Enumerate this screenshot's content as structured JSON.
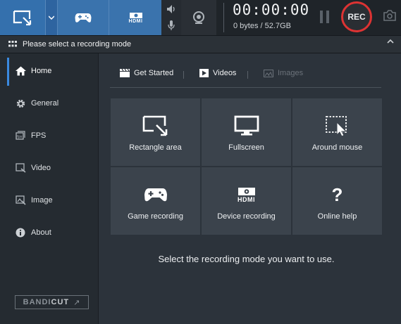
{
  "toolbar": {
    "timer": "00:00:00",
    "bytes": "0 bytes / 52.7GB",
    "rec_label": "REC",
    "hdmi_label": "HDMI"
  },
  "modebar": {
    "title": "Please select a recording mode"
  },
  "sidebar": {
    "items": [
      {
        "label": "Home",
        "icon": "home-icon",
        "active": true
      },
      {
        "label": "General",
        "icon": "gear-icon"
      },
      {
        "label": "FPS",
        "icon": "fps-icon"
      },
      {
        "label": "Video",
        "icon": "video-icon"
      },
      {
        "label": "Image",
        "icon": "image-icon"
      },
      {
        "label": "About",
        "icon": "info-icon"
      }
    ],
    "bandicut": {
      "label_a": "BANDI",
      "label_b": "CUT",
      "arrow": "↗"
    }
  },
  "tabs": [
    {
      "label": "Get Started",
      "icon": "clapper-icon"
    },
    {
      "label": "Videos",
      "icon": "play-icon"
    },
    {
      "label": "Images",
      "icon": "picture-icon",
      "disabled": true
    }
  ],
  "tiles": [
    {
      "label": "Rectangle area",
      "icon": "rectangle-area-icon"
    },
    {
      "label": "Fullscreen",
      "icon": "monitor-icon"
    },
    {
      "label": "Around mouse",
      "icon": "mouse-area-icon"
    },
    {
      "label": "Game recording",
      "icon": "gamepad-icon"
    },
    {
      "label": "Device recording",
      "icon": "hdmi-device-icon"
    },
    {
      "label": "Online help",
      "icon": "question-icon"
    }
  ],
  "hint": "Select the recording mode you want to use.",
  "colors": {
    "accent": "#3a73ad",
    "rec_ring": "#dd3333",
    "tile_bg": "#3b434c"
  }
}
